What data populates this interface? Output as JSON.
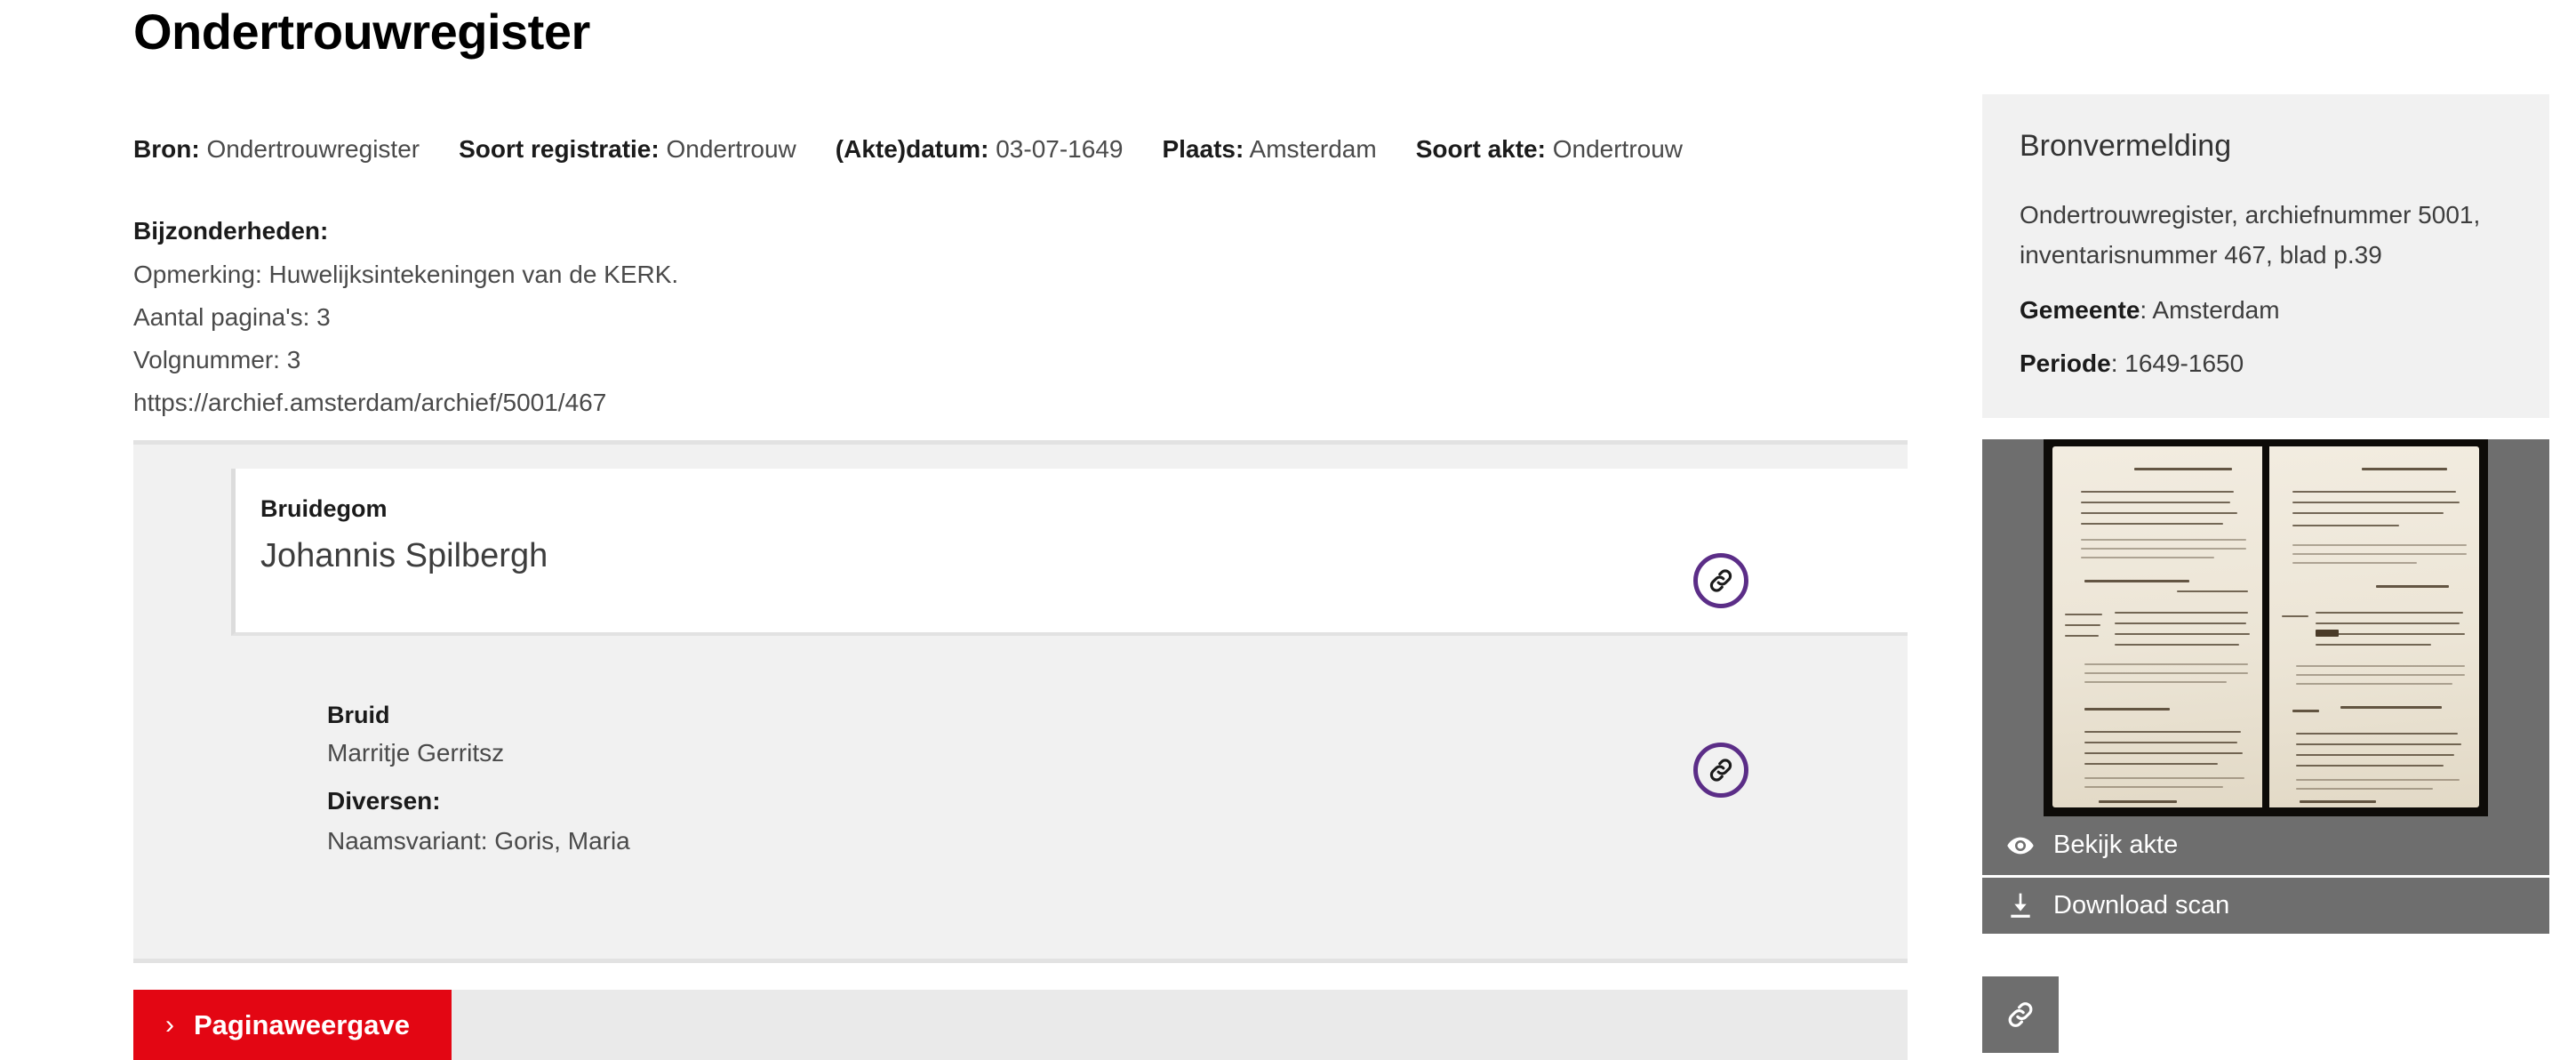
{
  "page_title": "Ondertrouwregister",
  "meta": [
    {
      "label": "Bron:",
      "value": "Ondertrouwregister"
    },
    {
      "label": "Soort registratie:",
      "value": "Ondertrouw"
    },
    {
      "label": "(Akte)datum:",
      "value": "03-07-1649"
    },
    {
      "label": "Plaats:",
      "value": "Amsterdam"
    },
    {
      "label": "Soort akte:",
      "value": "Ondertrouw"
    }
  ],
  "details": {
    "heading": "Bijzonderheden:",
    "lines": [
      "Opmerking: Huwelijksintekeningen van de KERK.",
      "Aantal pagina's: 3",
      "Volgnummer: 3",
      "https://archief.amsterdam/archief/5001/467"
    ]
  },
  "parties": {
    "groom": {
      "role": "Bruidegom",
      "name": "Johannis Spilbergh",
      "link_icon": "link-icon"
    },
    "bride": {
      "role": "Bruid",
      "name": "Marritje Gerritsz",
      "sub_heading": "Diversen:",
      "sub_value": "Naamsvariant: Goris, Maria",
      "link_icon": "link-icon"
    }
  },
  "bottom_bar": {
    "page_view_label": "Paginaweergave",
    "chevron": "›"
  },
  "sidebar": {
    "source": {
      "title": "Bronvermelding",
      "citation": "Ondertrouwregister, archiefnummer 5001, inventarisnummer 467, blad p.39",
      "municipality_label": "Gemeente",
      "municipality_value": ": Amsterdam",
      "period_label": "Periode",
      "period_value": ": 1649-1650"
    },
    "scan": {
      "thumbnail_alt": "scan-thumbnail",
      "view_label": "Bekijk akte",
      "view_icon": "eye-icon",
      "download_label": "Download scan",
      "download_icon": "download-icon"
    },
    "share_icon": "link-icon"
  },
  "colors": {
    "accent_red": "#e30613",
    "accent_purple": "#5b2d87",
    "panel_gray": "#f1f1f1",
    "button_gray": "#6e6e6e",
    "bar_gray": "#eaeaea"
  }
}
